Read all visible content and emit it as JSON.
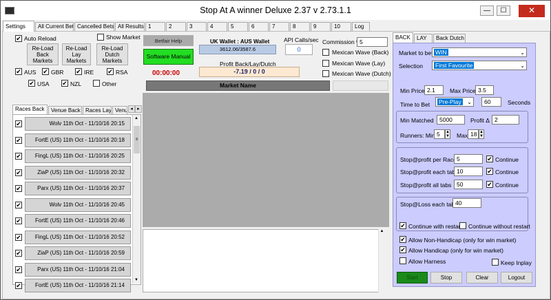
{
  "window": {
    "title": "Stop At A winner Deluxe 2.37 v 2.73.1.1"
  },
  "main_tabs": [
    "Settings",
    "All Current Bets",
    "Cancelled Bets",
    "All Results",
    "1",
    "2",
    "3",
    "4",
    "5",
    "6",
    "7",
    "8",
    "9",
    "10",
    "Log"
  ],
  "settings": {
    "auto_reload": "Auto Reload",
    "show_market": "Show Market",
    "reload_back": "Re-Load\nBack\nMarkets",
    "reload_lay": "Re-Load\nLay\nMarkets",
    "reload_dutch": "Re-Load\nDutch\nMarkets",
    "countries": [
      "AUS",
      "GBR",
      "IRE",
      "RSA",
      "USA",
      "NZL",
      "Other"
    ],
    "betfair_help": "Betfair Help",
    "software_manual": "Software Manual",
    "timer": "00:00:00",
    "wallet_label": "UK Wallet : AUS Wallet",
    "wallet_value": "3612.06/3587.6",
    "api_label": "API Calls/sec",
    "api_value": "0",
    "profit_label": "Profit Back/Lay/Dutch",
    "profit_value": "-7.19 / 0 / 0",
    "commission_label": "Commission %",
    "commission_value": "5",
    "mexican_back": "Mexican Wave (Back)",
    "mexican_lay": "Mexican Wave (Lay)",
    "mexican_dutch": "Mexican Wave (Dutch)",
    "market_name_header": "Market Name"
  },
  "race_tabs": [
    "Races Back",
    "Venue Back",
    "Races Lay",
    "Venu"
  ],
  "races": [
    "Wolv 11th Oct - 11/10/16 20:15",
    "FortE (US) 11th Oct - 11/10/16 20:18",
    "FingL (US) 11th Oct - 11/10/16 20:25",
    "ZiaP (US) 11th Oct - 11/10/16 20:32",
    "Parx (US) 11th Oct - 11/10/16 20:37",
    "Wolv 11th Oct - 11/10/16 20:45",
    "FortE (US) 11th Oct - 11/10/16 20:46",
    "FingL (US) 11th Oct - 11/10/16 20:52",
    "ZiaP (US) 11th Oct - 11/10/16 20:59",
    "Parx (US) 11th Oct - 11/10/16 21:04",
    "FortE (US) 11th Oct - 11/10/16 21:14"
  ],
  "right_tabs": [
    "BACK",
    "LAY",
    "Back Dutch"
  ],
  "back": {
    "market_label": "Market to bet",
    "market_value": "WIN",
    "selection_label": "Selection",
    "selection_value": "First Favourite",
    "min_price_label": "Min Price",
    "min_price": "2.1",
    "max_price_label": "Max Price",
    "max_price": "3.5",
    "time_label": "Time to Bet",
    "time_value": "Pre-Play",
    "time_seconds": "60",
    "seconds_label": "Seconds",
    "min_matched_label": "Min Matched",
    "min_matched": "5000",
    "profit_delta_label": "Profit Δ",
    "profit_delta": "2",
    "runners_label": "Runners: Min",
    "runners_min": "5",
    "runners_max_label": "Max",
    "runners_max": "18",
    "stop_profit_race_label": "Stop@profit per Race",
    "stop_profit_race": "5",
    "stop_profit_tab_label": "Stop@profit each tab",
    "stop_profit_tab": "10",
    "stop_profit_all_label": "Stop@profit all tabs",
    "stop_profit_all": "50",
    "continue": "Continue",
    "stop_loss_label": "Stop@Loss each tab",
    "stop_loss": "40",
    "continue_restart": "Continue with restart",
    "continue_no_restart": "Continue without restart",
    "allow_non_handicap": "Allow Non-Handicap (only for win market)",
    "allow_handicap": "Allow Handicap (only for win market)",
    "allow_harness": "Allow Harness",
    "keep_inplay": "Keep Inplay"
  },
  "buttons": {
    "start": "Start",
    "stop": "Stop",
    "clear": "Clear",
    "logout": "Logout"
  },
  "colors": {
    "panel": "#ccccff",
    "manual_green": "#22dd22",
    "start_green": "#1a8a1a",
    "timer_red": "#cc0000",
    "titlebar_close": "#c42b1c"
  }
}
